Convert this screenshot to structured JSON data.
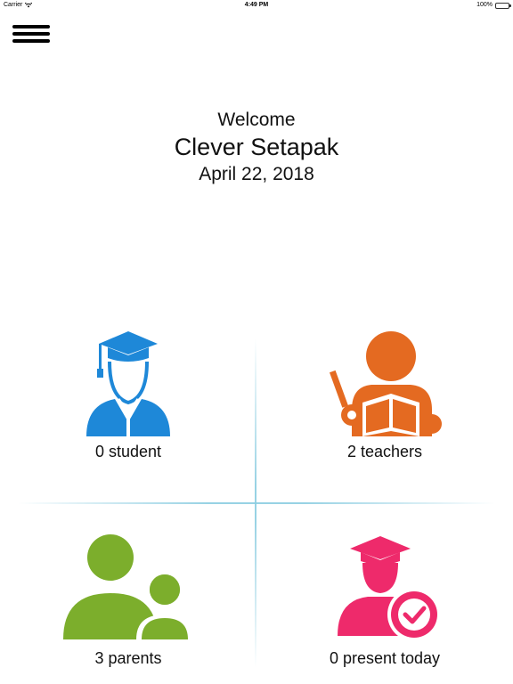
{
  "status_bar": {
    "carrier": "Carrier",
    "time": "4:49 PM",
    "battery": "100%"
  },
  "header": {
    "menu_icon": "hamburger-menu-icon"
  },
  "welcome": {
    "greeting": "Welcome",
    "school_name": "Clever Setapak",
    "date": "April 22, 2018"
  },
  "tiles": [
    {
      "label": "0 student",
      "icon": "student-graduate-icon",
      "color": "#1e88d8"
    },
    {
      "label": "2 teachers",
      "icon": "teacher-icon",
      "color": "#e46a21"
    },
    {
      "label": "3 parents",
      "icon": "parents-icon",
      "color": "#7cae2c"
    },
    {
      "label": "0 present today",
      "icon": "present-today-icon",
      "color": "#ee2a6b"
    }
  ],
  "colors": {
    "divider": "#8ccde1",
    "battery": "#4cd964"
  }
}
